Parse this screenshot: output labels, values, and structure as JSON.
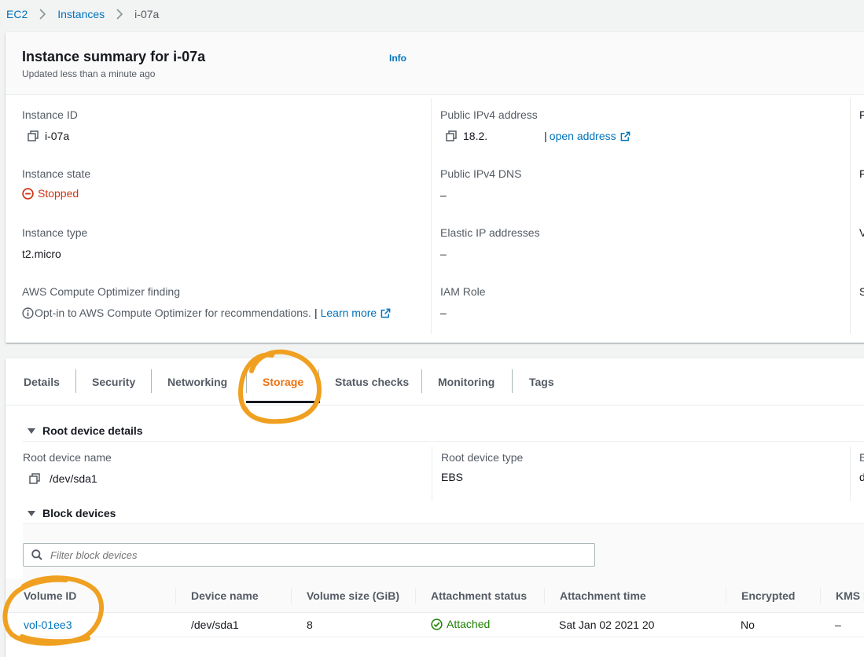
{
  "breadcrumb": {
    "root": "EC2",
    "instances": "Instances",
    "current": "i-07a"
  },
  "summary": {
    "title": "Instance summary for i-07a",
    "updated": "Updated less than a minute ago",
    "info": "Info",
    "instance_id": {
      "label": "Instance ID",
      "value": "i-07a"
    },
    "instance_state": {
      "label": "Instance state",
      "value": "Stopped"
    },
    "instance_type": {
      "label": "Instance type",
      "value": "t2.micro"
    },
    "optimizer": {
      "label": "AWS Compute Optimizer finding",
      "text": "Opt-in to AWS Compute Optimizer for recommendations.",
      "sep": "|",
      "link": "Learn more"
    },
    "public_ipv4": {
      "label": "Public IPv4 address",
      "value": "18.2.",
      "sep": "|",
      "link": "open address"
    },
    "public_dns": {
      "label": "Public IPv4 DNS",
      "value": "–"
    },
    "elastic_ip": {
      "label": "Elastic IP addresses",
      "value": "–"
    },
    "iam_role": {
      "label": "IAM Role",
      "value": "–"
    },
    "col3_cut": [
      "F",
      "F",
      "V",
      "S"
    ]
  },
  "tabs": [
    "Details",
    "Security",
    "Networking",
    "Storage",
    "Status checks",
    "Monitoring",
    "Tags"
  ],
  "active_tab": "Storage",
  "storage": {
    "root_section": "Root device details",
    "root_name_label": "Root device name",
    "root_name_value": "/dev/sda1",
    "root_type_label": "Root device type",
    "root_type_value": "EBS",
    "col3_label_cut": "E",
    "col3_value_cut": "d",
    "block_section": "Block devices",
    "filter_placeholder": "Filter block devices",
    "columns": [
      "Volume ID",
      "Device name",
      "Volume size (GiB)",
      "Attachment status",
      "Attachment time",
      "Encrypted",
      "KMS I"
    ],
    "rows": [
      {
        "volume_id": "vol-01ee3",
        "device": "/dev/sda1",
        "size": "8",
        "status": "Attached",
        "time": "Sat Jan 02 2021 20",
        "encrypted": "No",
        "kms": "–"
      }
    ]
  },
  "colors": {
    "link": "#0073bb",
    "accent": "#ec7211",
    "stopped": "#d13212",
    "attached": "#1d8102",
    "annotation": "#f0a020"
  }
}
